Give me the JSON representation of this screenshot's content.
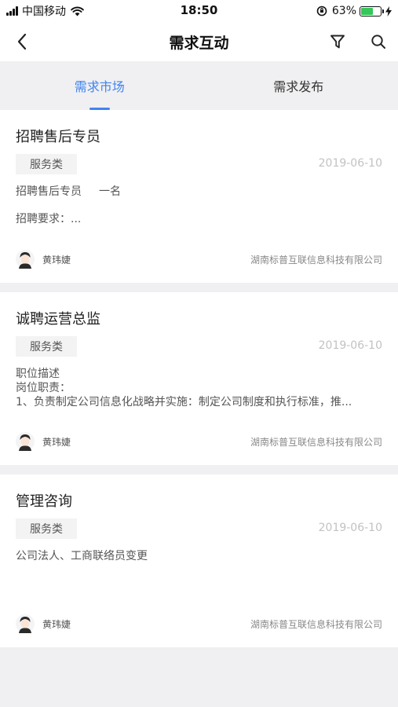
{
  "status_bar": {
    "carrier": "中国移动",
    "time": "18:50",
    "battery": "63%",
    "battery_level": 0.63,
    "battery_color": "#34c759"
  },
  "nav": {
    "title": "需求互动",
    "back_icon": "chevron-left-icon",
    "filter_icon": "filter-icon",
    "search_icon": "search-icon"
  },
  "tabs": [
    {
      "label": "需求市场",
      "active": true
    },
    {
      "label": "需求发布",
      "active": false
    }
  ],
  "accent_color": "#3f83f0",
  "cards": [
    {
      "title": "招聘售后专员",
      "tag": "服务类",
      "date": "2019-06-10",
      "desc_line1_a": "招聘售后专员",
      "desc_line1_b": "一名",
      "desc_line2": "招聘要求：...",
      "author": "黄玮婕",
      "company": "湖南标普互联信息科技有限公司"
    },
    {
      "title": "诚聘运营总监",
      "tag": "服务类",
      "date": "2019-06-10",
      "desc_line1": "职位描述",
      "desc_line2": "岗位职责：",
      "desc_line3": "1、负责制定公司信息化战略并实施：制定公司制度和执行标准，推...",
      "author": "黄玮婕",
      "company": "湖南标普互联信息科技有限公司"
    },
    {
      "title": "管理咨询",
      "tag": "服务类",
      "date": "2019-06-10",
      "desc_line1": "公司法人、工商联络员变更",
      "author": "黄玮婕",
      "company": "湖南标普互联信息科技有限公司"
    }
  ]
}
